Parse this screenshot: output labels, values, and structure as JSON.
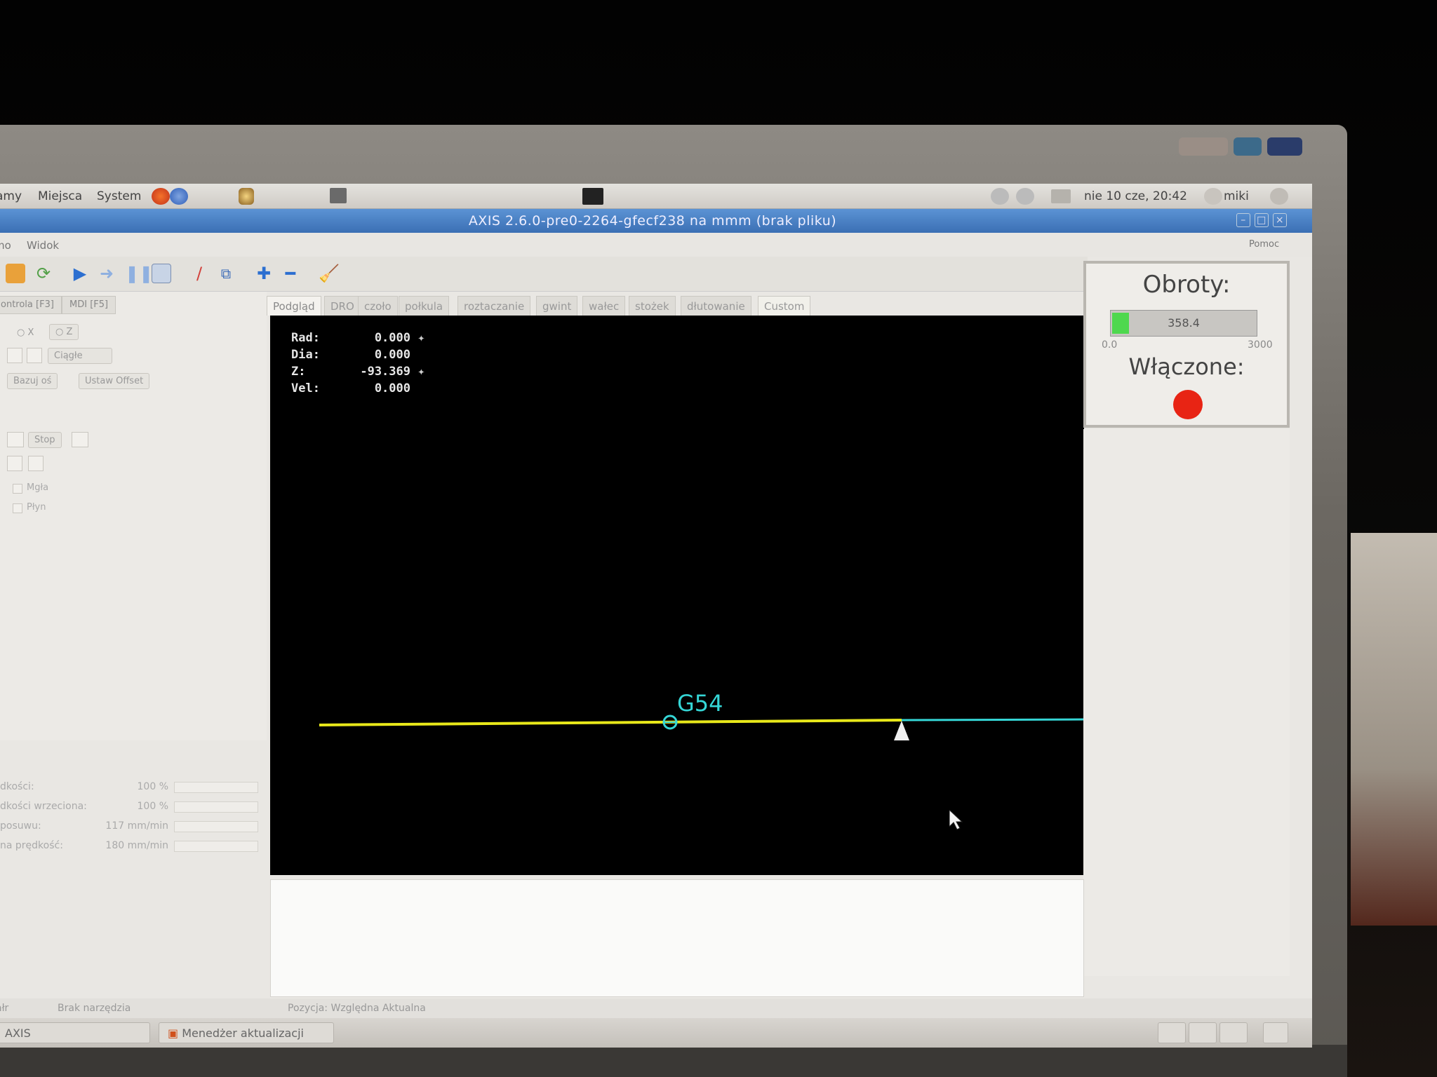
{
  "gnome_panel": {
    "menu_apps": "amy",
    "menu_places": "Miejsca",
    "menu_system": "System",
    "clock": "nie 10 cze, 20:42",
    "user": "miki"
  },
  "window": {
    "title": "AXIS 2.6.0-pre0-2264-gfecf238 na mmm (brak pliku)",
    "help_menu": "Pomoc",
    "menu_file": "mo",
    "menu_view": "Widok"
  },
  "left_panel": {
    "tab_manual": "ontrola [F3]",
    "tab_mdi": "MDI [F5]",
    "axis_x": "X",
    "axis_z": "Z",
    "jog_mode": "Ciągłe",
    "home_button": "Bazuj oś",
    "offset_button": "Ustaw Offset",
    "spindle_stop": "Stop",
    "coolant_mist": "Mgła",
    "coolant_flood": "Płyn"
  },
  "overrides": [
    {
      "label": "dkości:",
      "value": "100 %"
    },
    {
      "label": "dkości wrzeciona:",
      "value": "100 %"
    },
    {
      "label": "posuwu:",
      "value": "117 mm/min"
    },
    {
      "label": "na prędkość:",
      "value": "180 mm/min"
    }
  ],
  "tabs": [
    "Podgląd",
    "DRO",
    "czoło",
    "połkula",
    "roztaczanie",
    "gwint",
    "wałec",
    "stożek",
    "dłutowanie",
    "Custom"
  ],
  "dro": {
    "rad_label": "Rad:",
    "rad_value": "0.000",
    "dia_label": "Dia:",
    "dia_value": "0.000",
    "z_label": "Z:",
    "z_value": "-93.369",
    "vel_label": "Vel:",
    "vel_value": "0.000"
  },
  "preview": {
    "coord_system": "G54",
    "yellow": "#e8e81a",
    "cyan": "#35d6d6"
  },
  "hal": {
    "obroty_label": "Obroty:",
    "spindle_value": "358.4",
    "scale_min": "0.0",
    "scale_max": "3000",
    "spindle_fraction": 0.1195,
    "wlaczone_label": "Włączone:",
    "led_color": "#e82414"
  },
  "statusbar": {
    "left": "ałr",
    "tool": "Brak narzędzia",
    "position": "Pozycja: Względna Aktualna"
  },
  "taskbar": {
    "item_axis": "AXIS",
    "item_update": "Menedżer aktualizacji"
  }
}
